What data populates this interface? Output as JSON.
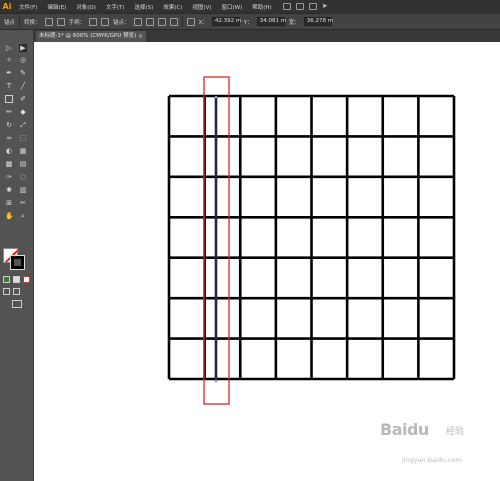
{
  "app": {
    "logo": "Ai"
  },
  "menubar": {
    "items": [
      "文件(F)",
      "编辑(E)",
      "对象(O)",
      "文字(T)",
      "选择(S)",
      "效果(C)",
      "视图(V)",
      "窗口(W)",
      "帮助(H)"
    ]
  },
  "controlbar": {
    "anchor_label": "锚点",
    "convert_label": "转换：",
    "handle_label": "手柄：",
    "anchor_label2": "锚点：",
    "x_label": "X：",
    "x_value": "42.392 m",
    "y_label": "Y：",
    "y_value": "34.081 m",
    "w_label": "宽：",
    "w_value": "36.278 m"
  },
  "document": {
    "tab_title": "未标题-1* @ 600% (CMYK/GPU 预览)",
    "close_glyph": "×"
  },
  "watermark": {
    "brand": "Baidu",
    "sub": "经验",
    "url": "jingyan.baidu.com"
  },
  "colors": {
    "highlight": "#d9262b",
    "selected_path": "#1e2a44",
    "grid": "#000000"
  },
  "icons": [
    "selection-tool-icon",
    "direct-selection-tool-icon",
    "magic-wand-icon",
    "lasso-icon",
    "pen-icon",
    "curvature-icon",
    "type-icon",
    "line-icon",
    "rectangle-icon",
    "paintbrush-icon",
    "pencil-icon",
    "eraser-icon",
    "rotate-icon",
    "scale-icon",
    "width-icon",
    "free-transform-icon",
    "shape-builder-icon",
    "perspective-icon",
    "mesh-icon",
    "gradient-icon",
    "eyedropper-icon",
    "blend-icon",
    "symbol-sprayer-icon",
    "column-graph-icon",
    "artboard-icon",
    "slice-icon",
    "hand-icon",
    "zoom-icon"
  ]
}
